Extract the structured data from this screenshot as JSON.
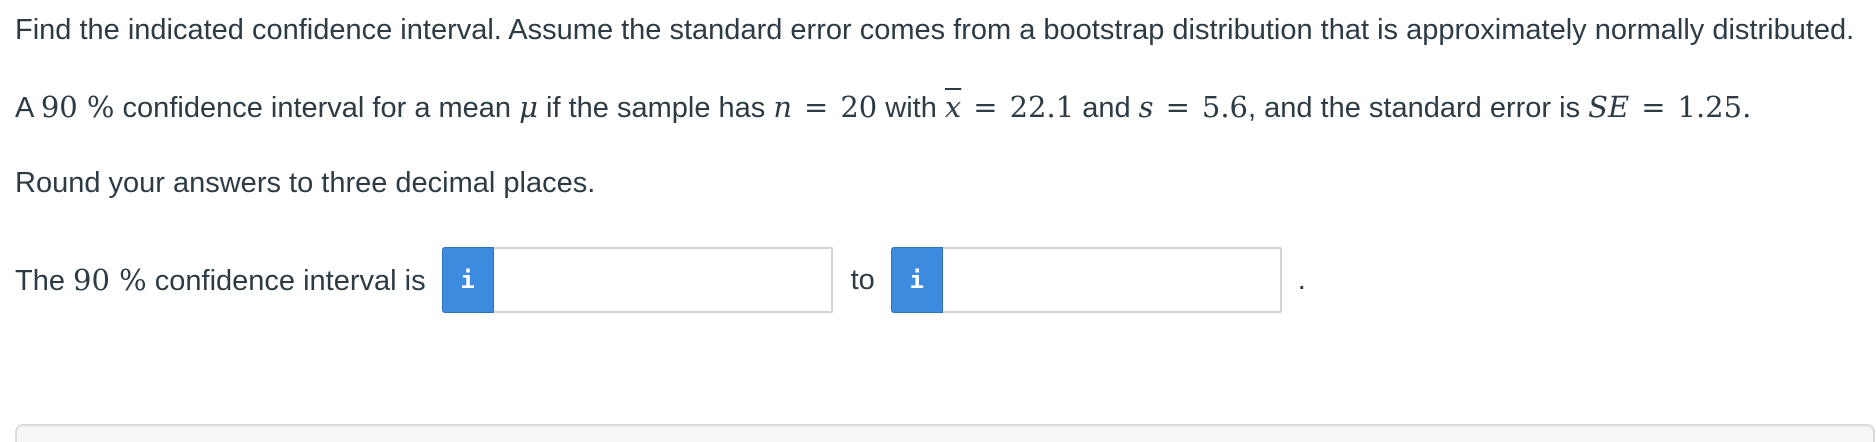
{
  "question": {
    "intro": "Find the indicated confidence interval. Assume the standard error comes from a bootstrap distribution that is approximately normally distributed.",
    "statement": {
      "t1": "A ",
      "conf_level": "90 %",
      "t2": "  confidence interval for a mean ",
      "mu": "μ",
      "t3": " if the sample has ",
      "n_sym": "n",
      "eq": "=",
      "n_val": "20",
      "t4": " with ",
      "xbar_sym": "x",
      "xbar_val": "22.1",
      "t5": " and ",
      "s_sym": "s",
      "s_val": "5.6",
      "t6": ", and the standard error is ",
      "se_sym": "SE",
      "se_val": "1.25",
      "end": "."
    },
    "rounding": "Round your answers to three decimal places."
  },
  "answer": {
    "prefix_pre": "The ",
    "conf_level": "90 %",
    "prefix_post": "  confidence interval is",
    "to_label": "to",
    "end_punct": ".",
    "info_glyph": "i",
    "info_icon": "info-icon",
    "lower_value": "",
    "upper_value": "",
    "info_color": "#3d8bdf"
  }
}
